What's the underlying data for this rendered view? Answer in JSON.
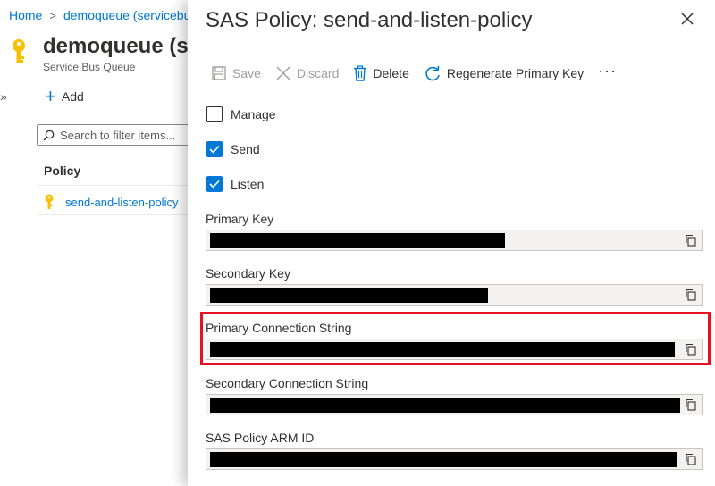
{
  "breadcrumb": {
    "home": "Home",
    "current": "demoqueue (servicebu"
  },
  "resource": {
    "name": "demoqueue (se",
    "type": "Service Bus Queue"
  },
  "left_blade": {
    "collapse_glyph": "»",
    "add_label": "Add",
    "filter_placeholder": "Search to filter items...",
    "column_header": "Policy",
    "policies": [
      {
        "name": "send-and-listen-policy",
        "icon": "key-icon"
      }
    ]
  },
  "panel": {
    "title": "SAS Policy: send-and-listen-policy",
    "toolbar": {
      "save": "Save",
      "discard": "Discard",
      "delete": "Delete",
      "regenerate": "Regenerate Primary Key",
      "more": "···"
    },
    "claims": {
      "manage": {
        "label": "Manage",
        "checked": false
      },
      "send": {
        "label": "Send",
        "checked": true
      },
      "listen": {
        "label": "Listen",
        "checked": true
      }
    },
    "fields": {
      "primary_key": "Primary Key",
      "secondary_key": "Secondary Key",
      "primary_connection_string": "Primary Connection String",
      "secondary_connection_string": "Secondary Connection String",
      "arm_id": "SAS Policy ARM ID"
    }
  },
  "colors": {
    "accent": "#0078d4",
    "key_icon": "#f8c000",
    "highlight": "#e81123",
    "redaction": "#000000"
  }
}
